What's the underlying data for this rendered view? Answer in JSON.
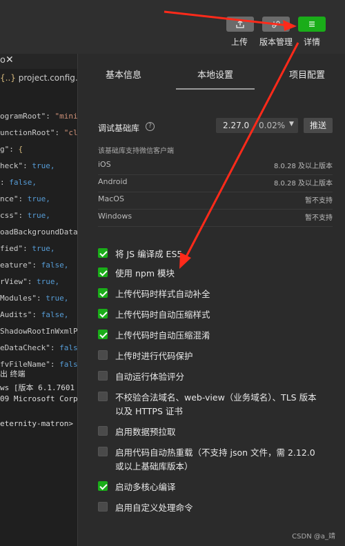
{
  "toolbar": {
    "upload_label": "上传",
    "version_label": "版本管理",
    "details_label": "详情"
  },
  "editor": {
    "file_tab": "project.config.json",
    "code_lines": [
      {
        "key": "ogramRoot\":",
        "val": "\"mini"
      },
      {
        "key": "unctionRoot\":",
        "val": "\"cl"
      },
      {
        "key": "g\":",
        "val": "{"
      },
      {
        "key": "heck\":",
        "val": "true,"
      },
      {
        "key": ":",
        "val": "false,"
      },
      {
        "key": "nce\":",
        "val": "true,"
      },
      {
        "key": "css\":",
        "val": "true,"
      },
      {
        "key": "oadBackgroundData",
        "val": ""
      },
      {
        "key": "fied\":",
        "val": "true,"
      },
      {
        "key": "eature\":",
        "val": "false,"
      },
      {
        "key": "rView\":",
        "val": "true,"
      },
      {
        "key": "Modules\":",
        "val": "true,"
      },
      {
        "key": "Audits\":",
        "val": "false,"
      },
      {
        "key": "ShadowRootInWxmlP",
        "val": ""
      },
      {
        "key": "eDataCheck\":",
        "val": "fals"
      },
      {
        "key": "fvFileName\":",
        "val": "fals"
      }
    ],
    "terminal_tabs": "出    终端",
    "terminal_lines": [
      "ws [版本 6.1.7601",
      "09 Microsoft Corp",
      "",
      "eternity-matron>"
    ]
  },
  "panel": {
    "tabs": [
      "基本信息",
      "本地设置",
      "项目配置"
    ],
    "active_tab": 1,
    "lib_label": "调试基础库",
    "lib_version": "2.27.0",
    "lib_percent": "0.02%",
    "push_label": "推送",
    "support_title": "该基础库支持微信客户端",
    "support": [
      {
        "name": "iOS",
        "value": "8.0.28 及以上版本"
      },
      {
        "name": "Android",
        "value": "8.0.28 及以上版本"
      },
      {
        "name": "MacOS",
        "value": "暂不支持"
      },
      {
        "name": "Windows",
        "value": "暂不支持"
      }
    ],
    "options": [
      {
        "label": "将 JS 编译成 ES5",
        "checked": true
      },
      {
        "label": "使用 npm 模块",
        "checked": true
      },
      {
        "label": "上传代码时样式自动补全",
        "checked": true
      },
      {
        "label": "上传代码时自动压缩样式",
        "checked": true
      },
      {
        "label": "上传代码时自动压缩混淆",
        "checked": true
      },
      {
        "label": "上传时进行代码保护",
        "checked": false
      },
      {
        "label": "自动运行体验评分",
        "checked": false
      },
      {
        "label": "不校验合法域名、web-view（业务域名）、TLS 版本以及 HTTPS 证书",
        "checked": false
      },
      {
        "label": "启用数据预拉取",
        "checked": false
      },
      {
        "label": "启用代码自动热重载（不支持 json 文件，需 2.12.0 或以上基础库版本）",
        "checked": false
      },
      {
        "label": "启动多核心编译",
        "checked": true
      },
      {
        "label": "启用自定义处理命令",
        "checked": false
      }
    ]
  },
  "watermark": "CSDN @a_靖",
  "colors": {
    "accent": "#1aad19",
    "arrow": "#ff2a1a"
  }
}
